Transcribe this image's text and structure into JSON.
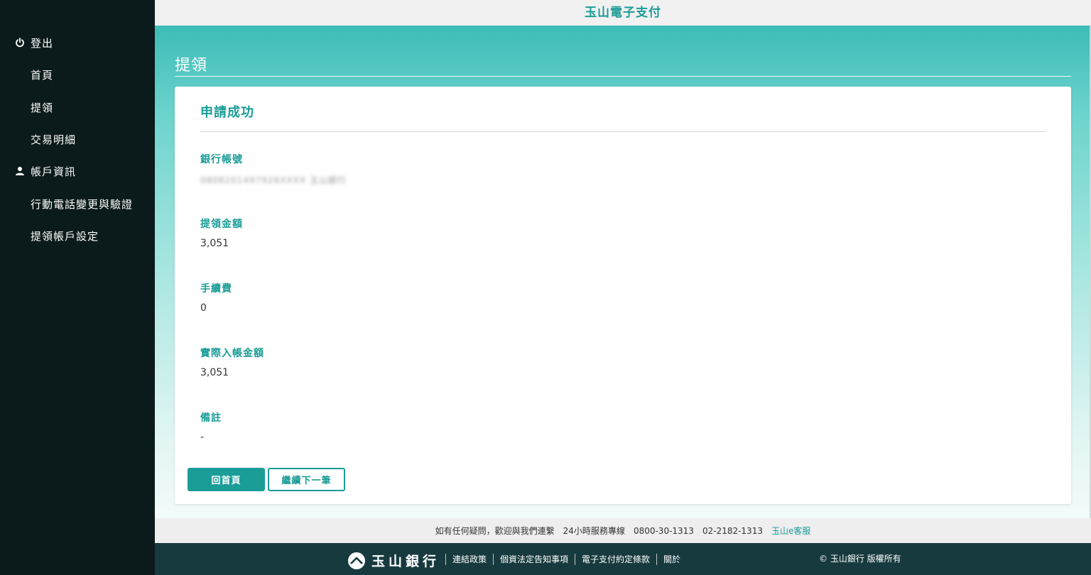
{
  "app": {
    "title": "玉山電子支付"
  },
  "sidebar": {
    "items": [
      {
        "label": "登出",
        "icon": "power-icon"
      },
      {
        "label": "首頁"
      },
      {
        "label": "提領"
      },
      {
        "label": "交易明細"
      },
      {
        "label": "帳戶資訊",
        "icon": "user-icon"
      },
      {
        "label": "行動電話變更與驗證"
      },
      {
        "label": "提領帳戶設定"
      }
    ]
  },
  "page": {
    "title": "提領",
    "card_title": "申請成功",
    "fields": [
      {
        "label": "銀行帳號",
        "value": "0808201497926XXXX 玉山銀行"
      },
      {
        "label": "提領金額",
        "value": "3,051"
      },
      {
        "label": "手續費",
        "value": "0"
      },
      {
        "label": "實際入帳金額",
        "value": "3,051"
      },
      {
        "label": "備註",
        "value": "-"
      }
    ],
    "buttons": {
      "home": "回首頁",
      "next": "繼續下一筆"
    }
  },
  "contact": {
    "text": "如有任何疑問，歡迎與我們連繫",
    "hotline_label": "24小時服務專線",
    "phone1": "0800-30-1313",
    "phone2": "02-2182-1313",
    "service_link": "玉山e客服"
  },
  "footer": {
    "logo_text": "玉山銀行",
    "links": [
      "連結政策",
      "個資法定告知事項",
      "電子支付約定條款",
      "關於"
    ],
    "copyright": "© 玉山銀行 版權所有"
  },
  "colors": {
    "accent": "#1a9c97",
    "sidebar_bg": "#0b1a1b",
    "footer_bg": "#173a3f"
  }
}
